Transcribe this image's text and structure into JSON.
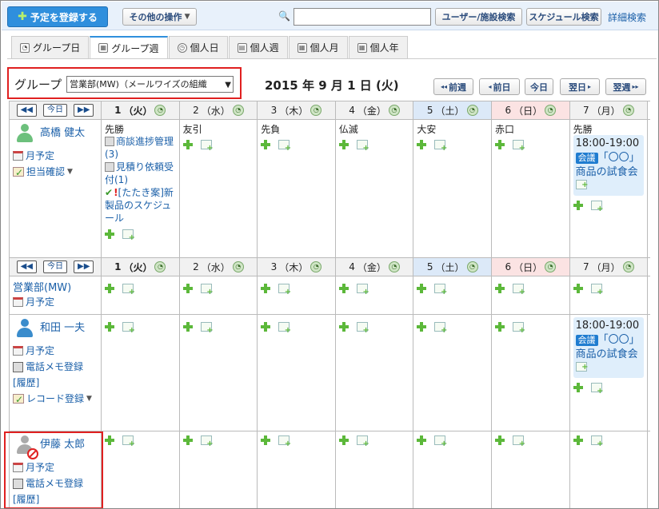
{
  "toolbar": {
    "register_label": "予定を登録する",
    "other_ops_label": "その他の操作",
    "search_placeholder": "",
    "user_facility_search_label": "ユーザー/施設検索",
    "schedule_search_label": "スケジュール検索",
    "detail_search_label": "詳細検索"
  },
  "tabs": [
    {
      "label": "グループ日",
      "icon": "group-day-icon"
    },
    {
      "label": "グループ週",
      "icon": "group-week-icon",
      "active": true
    },
    {
      "label": "個人日",
      "icon": "clock-icon"
    },
    {
      "label": "個人週",
      "icon": "personal-week-icon"
    },
    {
      "label": "個人月",
      "icon": "calendar-month-icon"
    },
    {
      "label": "個人年",
      "icon": "calendar-year-icon"
    }
  ],
  "group": {
    "label": "グループ",
    "selected": "営業部(MW)（メールワイズの組織"
  },
  "date_title": "2015 年 9 月 1 日 (火)",
  "nav": {
    "prev_week": "前週",
    "prev_day": "前日",
    "today": "今日",
    "next_day": "翌日",
    "next_week": "翌週"
  },
  "mini_nav": {
    "prev": "◀◀",
    "today": "今日",
    "next": "▶▶"
  },
  "days": [
    {
      "num": "1",
      "dow": "（火）",
      "rokuyo": "先勝"
    },
    {
      "num": "2",
      "dow": "（水）",
      "rokuyo": "友引"
    },
    {
      "num": "3",
      "dow": "（木）",
      "rokuyo": "先負"
    },
    {
      "num": "4",
      "dow": "（金）",
      "rokuyo": "仏滅"
    },
    {
      "num": "5",
      "dow": "（土）",
      "rokuyo": "大安"
    },
    {
      "num": "6",
      "dow": "（日）",
      "rokuyo": "赤口"
    },
    {
      "num": "7",
      "dow": "（月）",
      "rokuyo": "先勝"
    }
  ],
  "user1": {
    "name": "高橋 健太",
    "month_link": "月予定",
    "confirm_link": "担当確認",
    "events_day1": [
      {
        "text": "商談進捗管理(3)"
      },
      {
        "text": "見積り依頼受付(1)"
      },
      {
        "prefix": "!",
        "text": "[たたき案]新製品のスケジュール"
      }
    ],
    "event_day7": {
      "time": "18:00-19:00",
      "badge": "会議",
      "title": "「〇〇」商品の試食会"
    }
  },
  "org": {
    "name": "営業部(MW)",
    "month_link": "月予定"
  },
  "user2": {
    "name": "和田 一夫",
    "month_link": "月予定",
    "memo_link": "電話メモ登録",
    "history_link": "[履歴]",
    "record_link": "レコード登録",
    "event_day7": {
      "time": "18:00-19:00",
      "badge": "会議",
      "title": "「〇〇」商品の試食会"
    }
  },
  "user3": {
    "name": "伊藤 太郎",
    "month_link": "月予定",
    "memo_link": "電話メモ登録",
    "history_link": "[履歴]"
  }
}
